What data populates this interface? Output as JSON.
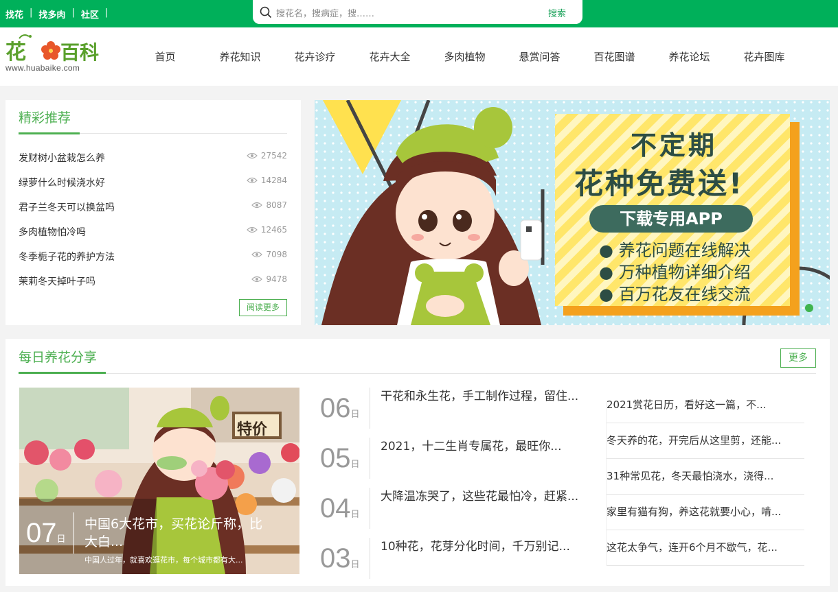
{
  "topbar": {
    "links": [
      "找花",
      "找多肉",
      "社区"
    ],
    "separator": "|",
    "search_placeholder": "搜花名，搜病症，搜……",
    "search_button": "搜索"
  },
  "logo": {
    "text": "花百科",
    "url": "www.huabaike.com"
  },
  "nav": [
    "首页",
    "养花知识",
    "花卉诊疗",
    "花卉大全",
    "多肉植物",
    "悬赏问答",
    "百花图谱",
    "养花论坛",
    "花卉图库"
  ],
  "recommend": {
    "title": "精彩推荐",
    "items": [
      {
        "title": "发财树小盆栽怎么养",
        "views": "27542"
      },
      {
        "title": "绿萝什么时候浇水好",
        "views": "14284"
      },
      {
        "title": "君子兰冬天可以换盆吗",
        "views": "8087"
      },
      {
        "title": "多肉植物怕冷吗",
        "views": "12465"
      },
      {
        "title": "冬季栀子花的养护方法",
        "views": "7098"
      },
      {
        "title": "茉莉冬天掉叶子吗",
        "views": "9478"
      }
    ],
    "more": "阅读更多"
  },
  "banner": {
    "line1": "不定期",
    "line2": "花种免费送!",
    "pill": "下载专用APP",
    "bullets": [
      "养花问题在线解决",
      "万种植物详细介绍",
      "百万花友在线交流"
    ]
  },
  "daily": {
    "title": "每日养花分享",
    "more": "更多",
    "feature": {
      "day": "07",
      "ri": "日",
      "title": "中国6大花市，买花论斤称，比大白...",
      "desc": "中国人过年，就喜欢逛花市，每个城市都有大...",
      "sign": "特价"
    },
    "dated": [
      {
        "day": "06",
        "ri": "日",
        "title": "干花和永生花，手工制作过程，留住..."
      },
      {
        "day": "05",
        "ri": "日",
        "title": "2021，十二生肖专属花，最旺你..."
      },
      {
        "day": "04",
        "ri": "日",
        "title": "大降温冻哭了，这些花最怕冷，赶紧..."
      },
      {
        "day": "03",
        "ri": "日",
        "title": "10种花，花芽分化时间，千万别记..."
      }
    ],
    "list": [
      "2021赏花日历，看好这一篇，不...",
      "冬天养的花，开完后从这里剪，还能...",
      "31种常见花，冬天最怕浇水，浇得...",
      "家里有猫有狗，养这花就要小心，啃...",
      "这花太争气，连开6个月不歇气，花..."
    ]
  },
  "colors": {
    "brand_green": "#00b05a",
    "accent_green": "#4caf50"
  }
}
